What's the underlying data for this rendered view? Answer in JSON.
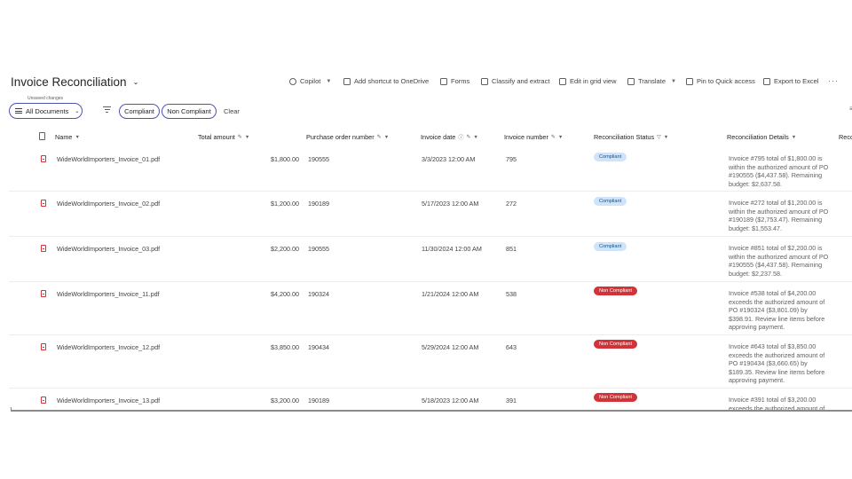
{
  "title": "Invoice Reconciliation",
  "toolbar": [
    {
      "label": "Copilot",
      "dropdown": true,
      "icon": "copilot-icon"
    },
    {
      "label": "Add shortcut to OneDrive",
      "dropdown": false,
      "icon": "shortcut-icon"
    },
    {
      "label": "Forms",
      "dropdown": false,
      "icon": "forms-icon"
    },
    {
      "label": "Classify and extract",
      "dropdown": false,
      "icon": "classify-icon"
    },
    {
      "label": "Edit in grid view",
      "dropdown": false,
      "icon": "grid-icon"
    },
    {
      "label": "Translate",
      "dropdown": true,
      "icon": "translate-icon"
    },
    {
      "label": "Pin to Quick access",
      "dropdown": false,
      "icon": "pin-icon"
    },
    {
      "label": "Export to Excel",
      "dropdown": false,
      "icon": "excel-icon"
    }
  ],
  "more_label": "···",
  "unsaved_changes": "Unsaved changes",
  "view": "All Documents",
  "filter_chips": [
    "Compliant",
    "Non Compliant"
  ],
  "clear_label": "Clear",
  "columns": {
    "name": "Name",
    "total_amount": "Total amount",
    "po_number": "Purchase order number",
    "invoice_date": "Invoice date",
    "invoice_number": "Invoice number",
    "status": "Reconciliation Status",
    "details": "Reconciliation Details",
    "extra": "Reco"
  },
  "rows": [
    {
      "name": "WideWorldImporters_Invoice_01.pdf",
      "total": "$1,800.00",
      "po": "190555",
      "date": "3/3/2023 12:00 AM",
      "invoice": "795",
      "status": "Compliant",
      "compliant": true,
      "details": "Invoice #795 total of $1,800.00 is within the authorized amount of PO #190555 ($4,437.58). Remaining budget: $2,637.58."
    },
    {
      "name": "WideWorldImporters_Invoice_02.pdf",
      "total": "$1,200.00",
      "po": "190189",
      "date": "5/17/2023 12:00 AM",
      "invoice": "272",
      "status": "Compliant",
      "compliant": true,
      "details": "Invoice #272 total of $1,200.00 is within the authorized amount of PO #190189 ($2,753.47). Remaining budget: $1,553.47."
    },
    {
      "name": "WideWorldImporters_Invoice_03.pdf",
      "total": "$2,200.00",
      "po": "190555",
      "date": "11/30/2024 12:00 AM",
      "invoice": "851",
      "status": "Compliant",
      "compliant": true,
      "details": "Invoice #851 total of $2,200.00 is within the authorized amount of PO #190555 ($4,437.58). Remaining budget: $2,237.58."
    },
    {
      "name": "WideWorldImporters_Invoice_11.pdf",
      "total": "$4,200.00",
      "po": "190324",
      "date": "1/21/2024 12:00 AM",
      "invoice": "538",
      "status": "Non Compliant",
      "compliant": false,
      "details": "Invoice #538 total of $4,200.00 exceeds the authorized amount of PO #190324 ($3,801.09) by $398.91. Review line items before approving payment."
    },
    {
      "name": "WideWorldImporters_Invoice_12.pdf",
      "total": "$3,850.00",
      "po": "190434",
      "date": "5/29/2024 12:00 AM",
      "invoice": "643",
      "status": "Non Compliant",
      "compliant": false,
      "details": "Invoice #643 total of $3,850.00 exceeds the authorized amount of PO #190434 ($3,660.65) by $189.35. Review line items before approving payment."
    },
    {
      "name": "WideWorldImporters_Invoice_13.pdf",
      "total": "$3,200.00",
      "po": "190189",
      "date": "5/18/2023 12:00 AM",
      "invoice": "391",
      "status": "Non Compliant",
      "compliant": false,
      "details": "Invoice #391 total of $3,200.00 exceeds the authorized amount of"
    }
  ]
}
